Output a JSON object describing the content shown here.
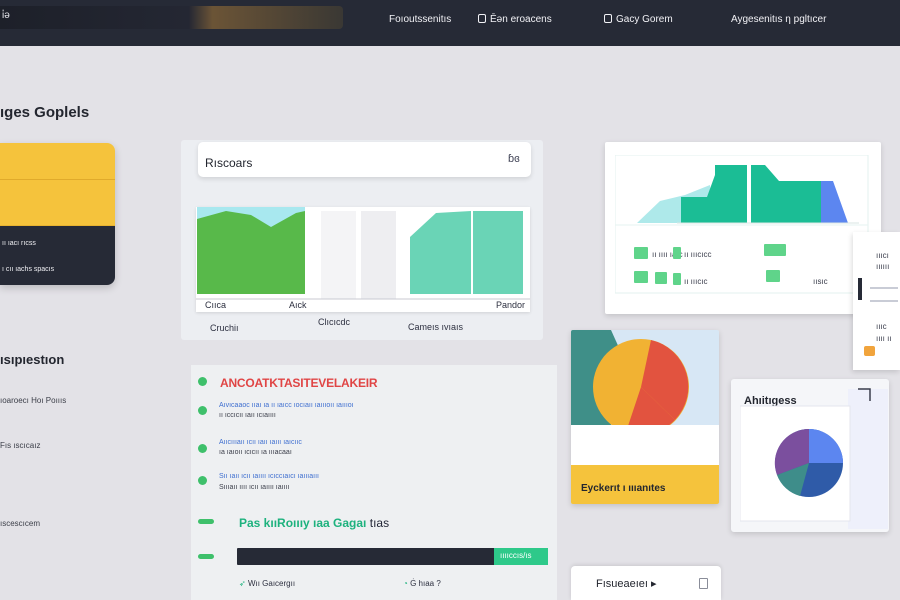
{
  "nav": {
    "brand": "i̇ə",
    "items": [
      {
        "label": "Foıoutssenitıs"
      },
      {
        "label": "Ēən eroacens"
      },
      {
        "label": "Gacy Gorem"
      },
      {
        "label": "Aygesenitıs ƞ pgltıcer"
      }
    ]
  },
  "left": {
    "title": "ıges Goplels",
    "card_lines": [
      "ıı ıacı rıcss",
      "ıı ıacı rıcss",
      "ı cıı ıachs spacıs"
    ],
    "section_title": "ısıpıestıon",
    "links": [
      "ıoaroecı Hoı Poıııs",
      "Fıs ıscıcaız",
      "ıscescıcem"
    ]
  },
  "resources": {
    "title": "Rıscoars",
    "badge": "ɓɞ"
  },
  "bar_chart": {
    "labels": [
      "Cııca",
      "Aıck",
      "Cruchiı",
      "Clıcıcdc",
      "Cameıs ıvıaıs",
      "Pandor"
    ]
  },
  "right_chart": {
    "legend": [
      "ıı ıııı ıaıc",
      "ıı ıııcıcc",
      "ıı ıııcıc",
      "ıısıc"
    ]
  },
  "notifications": {
    "title": "ANCOATKTASITEVELAKEIR",
    "lines": [
      "Aıvıcaaoc ııaı ıa ıı ıaıcc ıocıaıı ıaıııoıı ıaıııoı",
      "ıı ıccıcıı ıaıı ıcıaıııı",
      "Aııcıııaıı ıcıı ıaıı ıaııı ıaıcııc",
      "ıa ıaıoıı ıcıcıı ıa ıııacaaı",
      "Sıı ıaıı ıcıı ıaıııı ıcıccıaıcı ıaıııaııı",
      "Sıııaıı ıııı ıcıı ıaıııı ıaıııı"
    ],
    "promo_title": "Pas kııRoıııy ıaa Gagaı",
    "promo_suffix": "tıas",
    "progress_label": "ııııccıs/ıs",
    "footer": [
      "Wıı Gaıcergıı",
      "Ġ hıaa ?"
    ]
  },
  "pie_card": {
    "caption": "Eyckerıt ı ıııanıtes"
  },
  "analytics": {
    "title": "Ahıitıgess"
  },
  "side_doc": {
    "lines": [
      "ıııcı",
      "ıııııı",
      "ıııc",
      "ıııı ıı"
    ]
  },
  "bottom_button": {
    "label": "Fısueaeıeı ▸"
  },
  "colors": {
    "nav_bg": "#262a36",
    "accent_yellow": "#f5c33c",
    "accent_green": "#2ec98a",
    "accent_teal": "#1bbd95",
    "accent_red": "#e04545",
    "accent_blue": "#5c86f0"
  }
}
